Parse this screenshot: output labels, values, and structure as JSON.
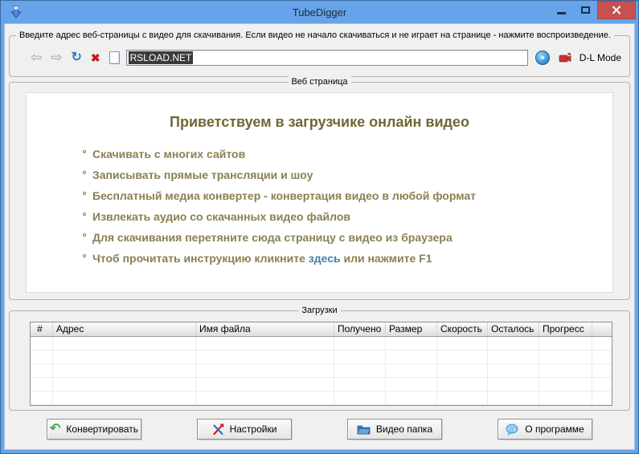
{
  "window": {
    "title": "TubeDigger"
  },
  "address_group": {
    "title": "Введите адрес веб-страницы с видео для скачивания. Если видео не начало скачиваться и не играет на странице - нажмите воспроизведение.",
    "url_value": "RSLOAD.NET",
    "dl_mode_label": "D-L Mode"
  },
  "icons": {
    "back": "⇦",
    "forward": "⇨",
    "refresh": "↻",
    "stop": "✖",
    "go": "»",
    "convert": "↶"
  },
  "webpage_group": {
    "title": "Веб страница",
    "heading": "Приветствуем в загрузчике онлайн видео",
    "bullets": [
      "Скачивать с многих сайтов",
      "Записывать прямые трансляции и шоу",
      "Бесплатный медиа конвертер - конвертация видео в любой формат",
      "Извлекать аудио со скачанных видео файлов",
      "Для скачивания перетяните сюда страницу с видео из браузера"
    ],
    "help_line": {
      "before": "Чтоб прочитать инструкцию кликните ",
      "link": "здесь",
      "after": " или нажмите F1"
    }
  },
  "downloads_group": {
    "title": "Загрузки",
    "columns": [
      "#",
      "Адрес",
      "Имя файла",
      "Получено",
      "Размер",
      "Скорость",
      "Осталось",
      "Прогресс"
    ],
    "empty_rows": 5
  },
  "footer_buttons": {
    "convert": "Конвертировать",
    "settings": "Настройки",
    "video_folder": "Видео папка",
    "about": "О программе"
  },
  "colors": {
    "titlebar_blue": "#67a3e8",
    "close_red": "#c75050",
    "content_gray": "#f0f0f0",
    "accent_olive": "#8a8052",
    "heading_olive": "#6f6832",
    "link_blue": "#4a80a8",
    "selection_dark": "#3b3b3b"
  }
}
